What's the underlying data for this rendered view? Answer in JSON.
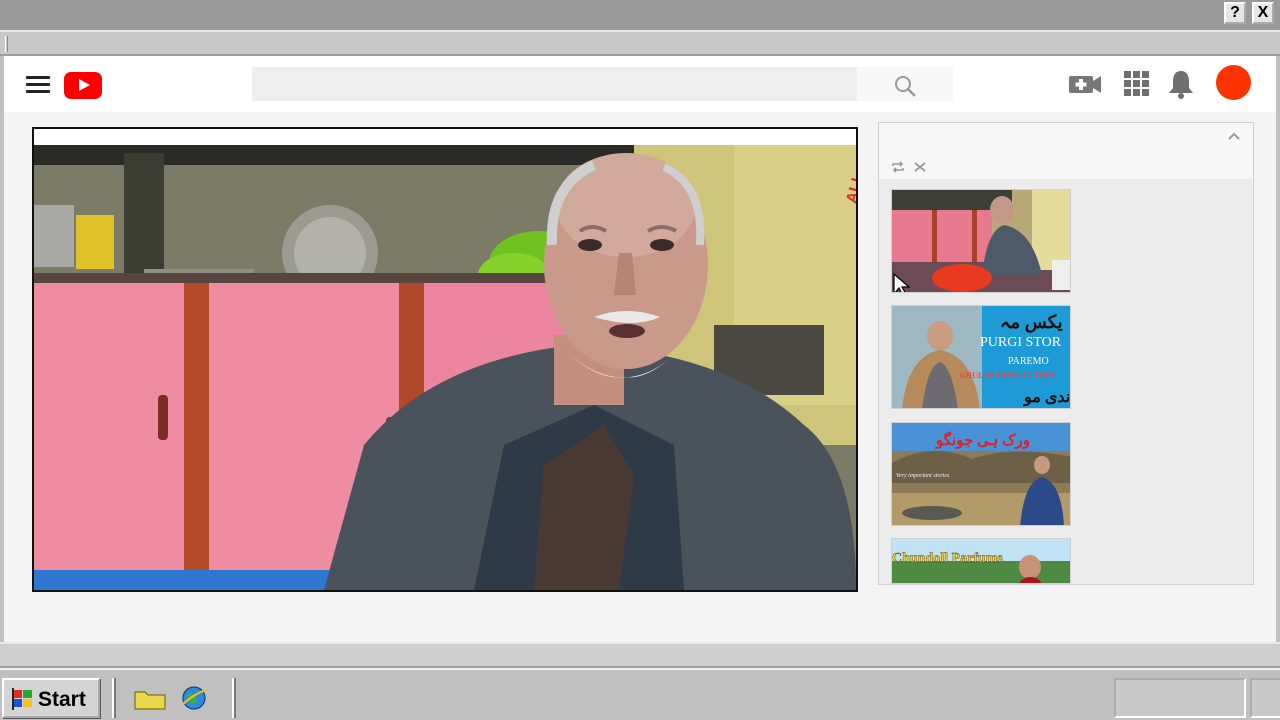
{
  "window": {
    "help_label": "?",
    "close_label": "X"
  },
  "header": {
    "search": {
      "value": "",
      "placeholder": ""
    },
    "icons": [
      "menu-icon",
      "youtube-logo",
      "search-icon",
      "create-video-icon",
      "apps-grid-icon",
      "notifications-bell-icon",
      "avatar"
    ]
  },
  "player": {
    "overlay_text": "ALL"
  },
  "queue": {
    "icons": [
      "chevron-up-icon",
      "loop-icon",
      "shuffle-icon"
    ],
    "items": [
      {
        "title_lines": []
      },
      {
        "title_top": "یکس مہ",
        "title_main": "PURGI STOR",
        "subtitle": "PAREMO",
        "byline": "GHULAM HUSSAIN THOY",
        "title_bottom": "ندی مو"
      },
      {
        "title_main": "ورک ہی جونگو",
        "caption": "Very important stories"
      },
      {
        "title_main": "Chundoll Parfums"
      }
    ]
  },
  "taskbar": {
    "start_label": "Start",
    "icons": [
      "windows-flag-icon",
      "folder-icon",
      "internet-globe-icon"
    ]
  },
  "colors": {
    "youtube_red": "#ff0000",
    "avatar": "#ff3300",
    "thumb_blue": "#1e9ad6"
  }
}
